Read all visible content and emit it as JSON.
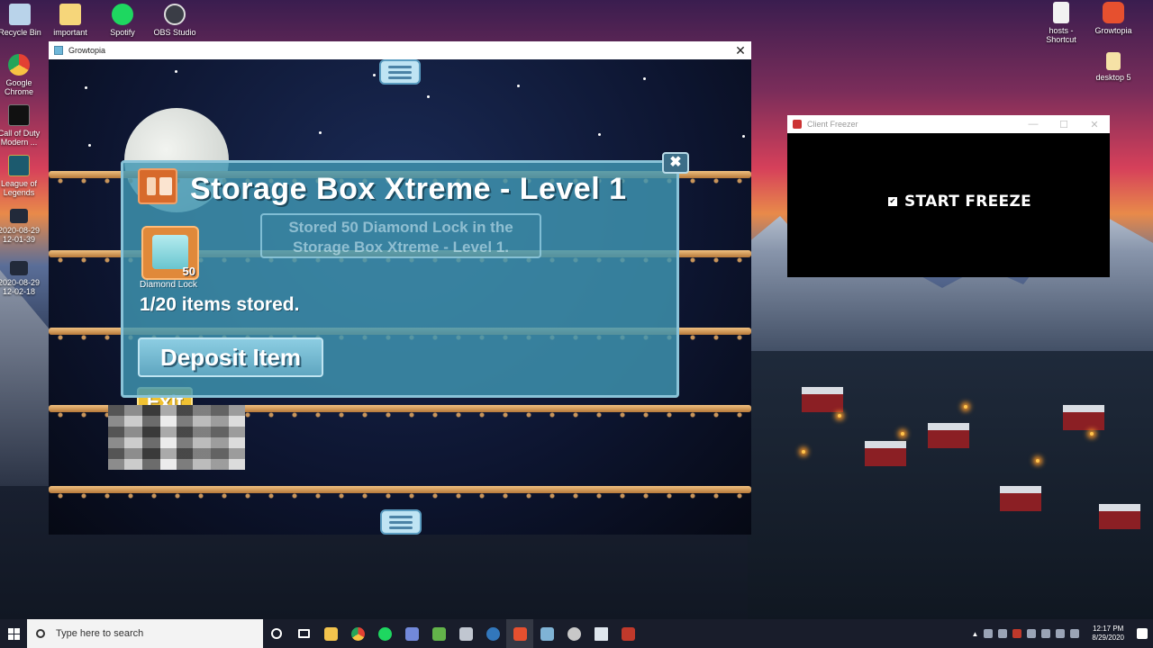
{
  "desktop": {
    "icons_left": [
      {
        "label": "Recycle Bin",
        "icon": "recycle-bin-icon",
        "color": "#b9d3ea"
      },
      {
        "label": "important",
        "icon": "folder-icon",
        "color": "#f6d67a"
      },
      {
        "label": "Spotify",
        "icon": "spotify-icon",
        "color": "#1ed760"
      },
      {
        "label": "OBS Studio",
        "icon": "obs-icon",
        "color": "#3a3d46"
      }
    ],
    "icons_column": [
      {
        "label": "Google Chrome",
        "icon": "chrome-icon",
        "color": "#e34133"
      },
      {
        "label": "Call of Duty Modern ...",
        "icon": "call-of-duty-icon",
        "color": "#111111"
      },
      {
        "label": "League of Legends",
        "icon": "league-icon",
        "color": "#1c5a6e"
      },
      {
        "label": "2020-08-29 12-01-39",
        "icon": "video-file-icon",
        "color": "#222a3a"
      },
      {
        "label": "2020-08-29 12-02-18",
        "icon": "video-file-icon",
        "color": "#222a3a"
      }
    ],
    "icons_right": [
      {
        "label": "hosts - Shortcut",
        "icon": "file-shortcut-icon",
        "color": "#f2f2f2"
      },
      {
        "label": "Growtopia",
        "icon": "growtopia-icon",
        "color": "#e6502f"
      },
      {
        "label": "desktop 5",
        "icon": "folder-icon",
        "color": "#f6e2a6"
      }
    ]
  },
  "growtopia_window": {
    "title": "Growtopia",
    "close_glyph": "✕",
    "dialog": {
      "title": "Storage Box Xtreme - Level 1",
      "toast": "Stored 50 Diamond Lock in the Storage Box Xtreme - Level 1.",
      "item_name": "Diamond Lock",
      "item_qty": "50",
      "stored_text": "1/20 items stored.",
      "deposit_label": "Deposit Item",
      "close_glyph": "✖"
    },
    "exit_label": "Exit"
  },
  "freezer_window": {
    "title": "Client Freezer",
    "start_label": "START FREEZE",
    "checkbox_glyph": "✔",
    "controls": [
      "—",
      "☐",
      "✕"
    ]
  },
  "taskbar": {
    "search_placeholder": "Type here to search",
    "time": "12:17 PM",
    "date": "8/29/2020",
    "apps": [
      {
        "icon": "cortana-icon",
        "color": "#ffffff"
      },
      {
        "icon": "task-view-icon",
        "color": "#ffffff"
      },
      {
        "icon": "file-explorer-icon",
        "color": "#f2c34d"
      },
      {
        "icon": "chrome-icon",
        "color": "#e34133"
      },
      {
        "icon": "spotify-icon",
        "color": "#1ed760"
      },
      {
        "icon": "discord-icon",
        "color": "#7289da"
      },
      {
        "icon": "notepad-icon",
        "color": "#63b34a"
      },
      {
        "icon": "tool-icon",
        "color": "#c0c6d0"
      },
      {
        "icon": "edge-icon",
        "color": "#3277bc"
      },
      {
        "icon": "growtopia-icon",
        "color": "#e6502f"
      },
      {
        "icon": "app-icon",
        "color": "#7fb3d5"
      },
      {
        "icon": "obs-icon",
        "color": "#c8c8c8"
      },
      {
        "icon": "window-icon",
        "color": "#dfe6ee"
      },
      {
        "icon": "client-freezer-icon",
        "color": "#c0392b"
      }
    ]
  }
}
